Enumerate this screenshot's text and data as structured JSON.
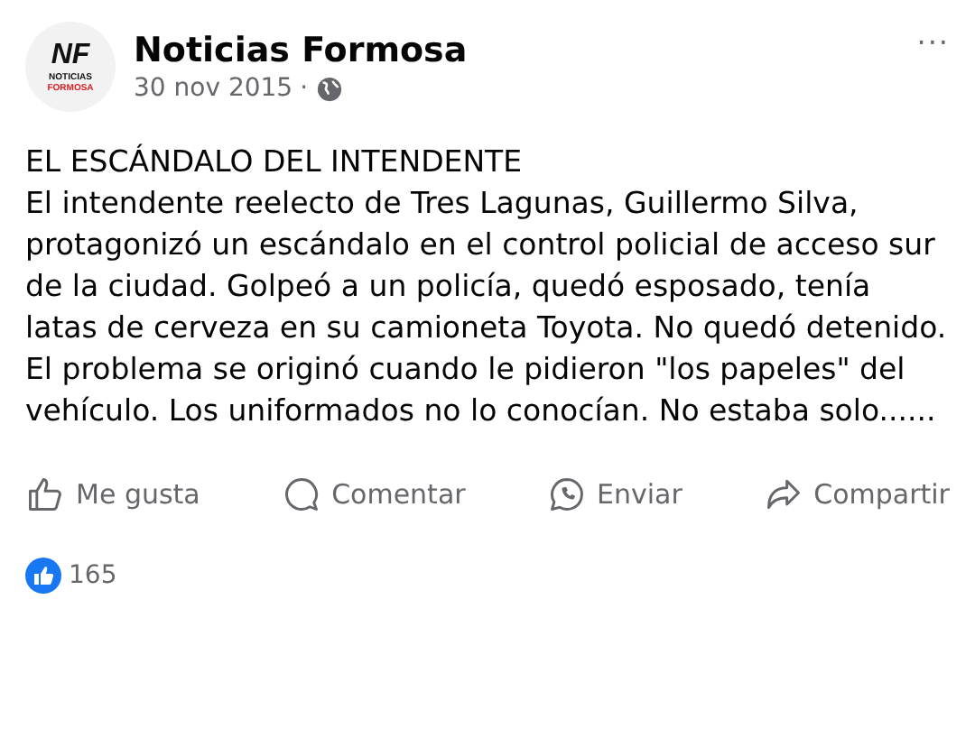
{
  "post": {
    "logo": {
      "initials": "NF",
      "line_1": "NOTICIAS",
      "line_2": "FORMOSA"
    },
    "author": "Noticias Formosa",
    "date": "30 nov 2015",
    "separator": "·",
    "menu": "···",
    "title": "EL ESCÁNDALO DEL INTENDENTE",
    "body": "El intendente reelecto de Tres Lagunas, Guillermo Silva, protagonizó un escándalo en el control policial de acceso sur de la ciudad. Golpeó a un policía, quedó esposado, tenía latas de cerveza en su camioneta Toyota. No quedó detenido. El problema se originó cuando le pidieron \"los papeles\" del vehículo. Los uniformados no lo conocían. No estaba solo......"
  },
  "actions": [
    {
      "kind": "like",
      "label": "Me gusta"
    },
    {
      "kind": "comment",
      "label": "Comentar"
    },
    {
      "kind": "whatsapp",
      "label": "Enviar"
    },
    {
      "kind": "share",
      "label": "Compartir"
    }
  ],
  "reactions": {
    "count": "165"
  }
}
